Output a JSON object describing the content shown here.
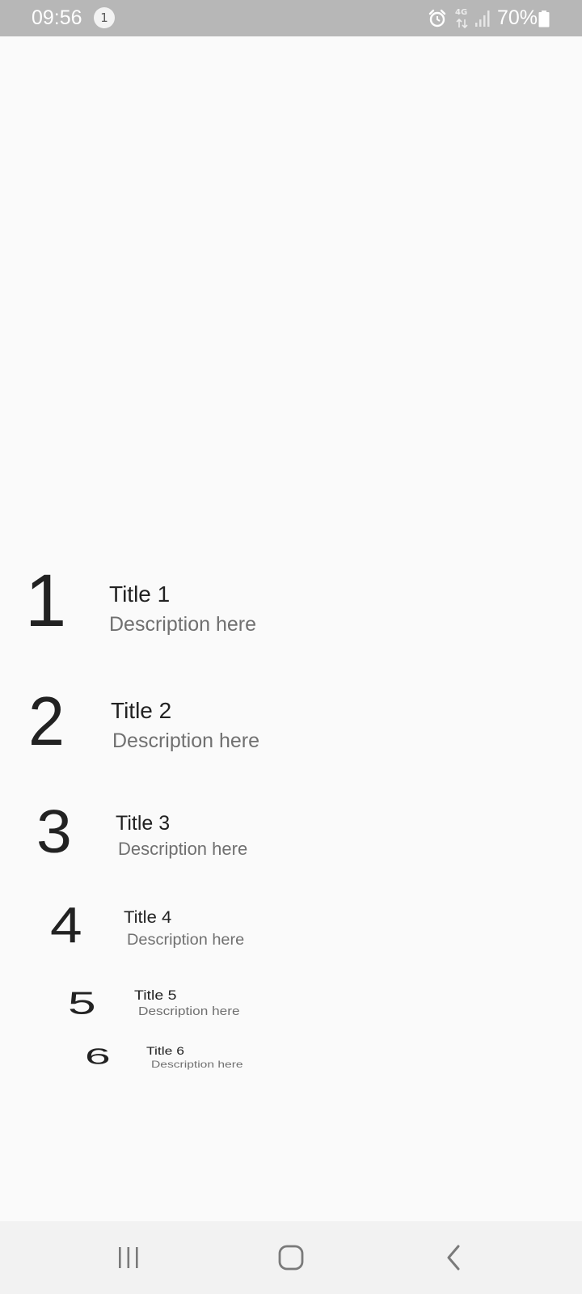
{
  "status_bar": {
    "time": "09:56",
    "notification_count": "1",
    "network_type": "4G",
    "battery_percent": "70%",
    "icons": [
      "alarm-icon",
      "network-4g-icon",
      "signal-icon",
      "battery-icon"
    ]
  },
  "list": {
    "items": [
      {
        "number": "1",
        "title": "Title 1",
        "description": "Description here"
      },
      {
        "number": "2",
        "title": "Title 2",
        "description": "Description here"
      },
      {
        "number": "3",
        "title": "Title 3",
        "description": "Description here"
      },
      {
        "number": "4",
        "title": "Title 4",
        "description": "Description here"
      },
      {
        "number": "5",
        "title": "Title 5",
        "description": "Description here"
      },
      {
        "number": "6",
        "title": "Title 6",
        "description": "Description here"
      }
    ]
  },
  "nav_bar": {
    "icons": [
      "recent-apps-icon",
      "home-icon",
      "back-icon"
    ]
  },
  "colors": {
    "status_bar_bg": "#b7b7b7",
    "page_bg": "#fafafa",
    "nav_bar_bg": "#f2f2f2",
    "title_text": "#222222",
    "description_text": "#707070",
    "nav_icon": "#7a7a7a"
  }
}
